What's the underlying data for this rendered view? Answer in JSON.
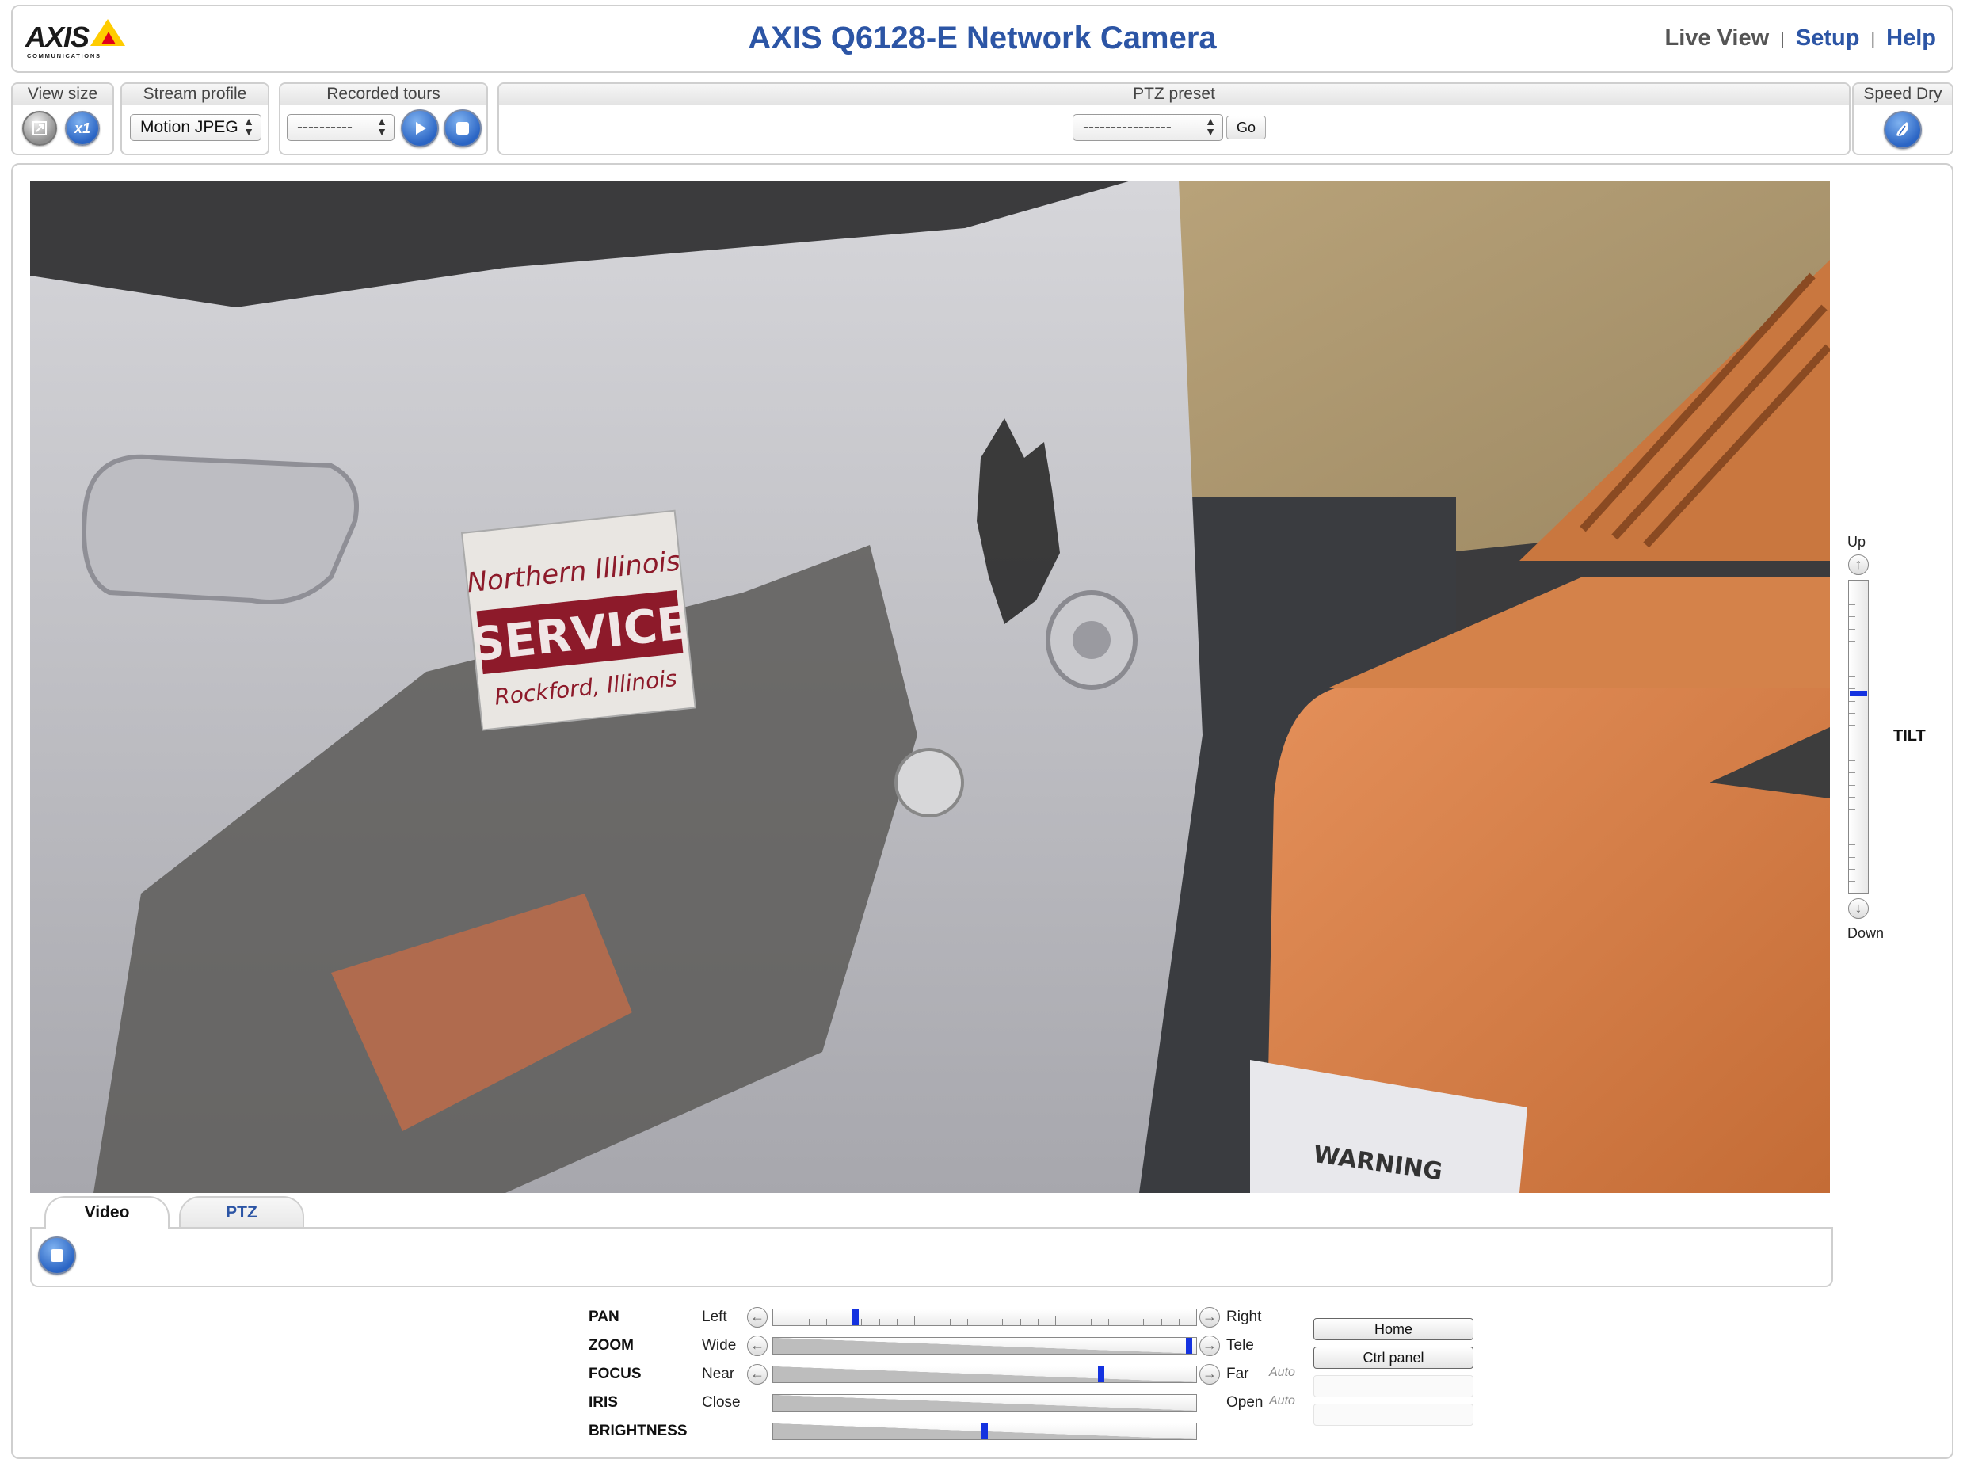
{
  "header": {
    "logo_text": "AXIS",
    "logo_subtext": "COMMUNICATIONS",
    "title": "AXIS Q6128-E Network Camera",
    "nav": {
      "live_view": "Live View",
      "setup": "Setup",
      "help": "Help",
      "separator": "|"
    }
  },
  "toolbar": {
    "view_size": {
      "label": "View size",
      "scale_button": "x1"
    },
    "stream_profile": {
      "label": "Stream profile",
      "selected": "Motion JPEG"
    },
    "recorded_tours": {
      "label": "Recorded tours",
      "selected": "----------"
    },
    "ptz_preset": {
      "label": "PTZ preset",
      "selected": "----------------",
      "go": "Go"
    },
    "speed_dry": {
      "label": "Speed Dry"
    }
  },
  "video": {
    "sign_line1": "Northern Illinois",
    "sign_line2": "SERVICE",
    "sign_line3": "Rockford, Illinois",
    "warning_text": "WARNING"
  },
  "tilt": {
    "up": "Up",
    "down": "Down",
    "label": "TILT",
    "position": 0.36
  },
  "tabs": {
    "video": "Video",
    "ptz": "PTZ"
  },
  "ptz_controls": [
    {
      "name": "PAN",
      "left": "Left",
      "right": "Right",
      "auto": "",
      "value": 0.19
    },
    {
      "name": "ZOOM",
      "left": "Wide",
      "right": "Tele",
      "auto": "",
      "value": 0.99
    },
    {
      "name": "FOCUS",
      "left": "Near",
      "right": "Far",
      "auto": "Auto",
      "value": 0.78
    },
    {
      "name": "IRIS",
      "left": "Close",
      "right": "Open",
      "auto": "Auto",
      "value": null
    },
    {
      "name": "BRIGHTNESS",
      "left": "",
      "right": "",
      "auto": "",
      "value": 0.5
    }
  ],
  "side_buttons": {
    "home": "Home",
    "ctrl_panel": "Ctrl panel"
  },
  "colors": {
    "brand_blue": "#2c55a5",
    "slider_handle": "#1432e0",
    "logo_yellow": "#ffcc00",
    "logo_red": "#e2001a"
  },
  "icons": {
    "view_size_full": "fullscreen-icon",
    "play_tour": "play-icon",
    "stop_tour": "stop-icon",
    "speed_dry": "speed-dry-icon",
    "video_stop": "stop-icon"
  }
}
